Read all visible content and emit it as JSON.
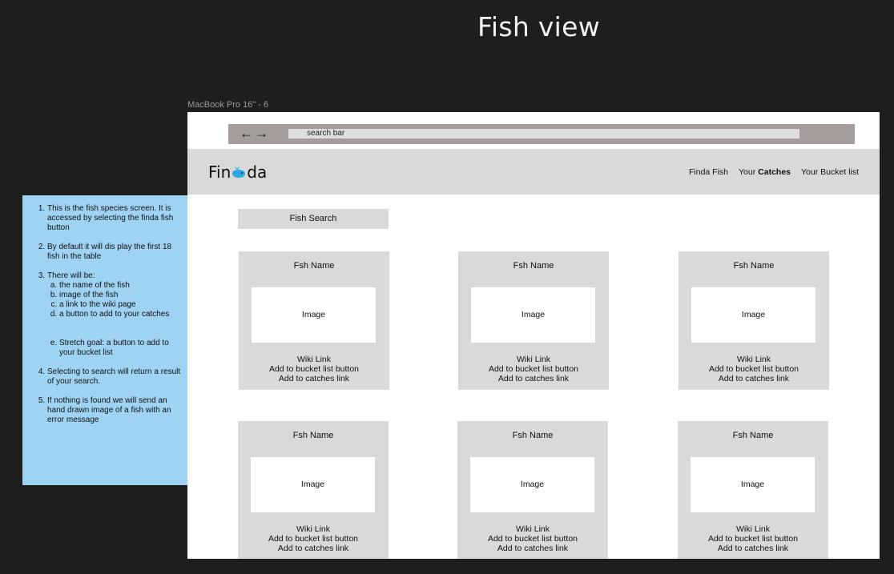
{
  "page_title": "Fish view",
  "frame_label": "MacBook Pro 16\" - 6",
  "browser": {
    "back_arrow": "←",
    "forward_arrow": "→",
    "search_text": "search bar"
  },
  "header": {
    "logo_prefix": "Fin",
    "logo_suffix": "da",
    "nav_finda": "Finda Fish",
    "nav_your": "Your",
    "nav_catches": "Catches",
    "nav_bucket": "Your Bucket list"
  },
  "fish_search_label": "Fish Search",
  "cards": [
    {
      "name": "Fsh Name",
      "image": "Image",
      "wiki": "Wiki Link",
      "bucket": "Add to bucket list button",
      "catches": "Add to catches link"
    },
    {
      "name": "Fsh Name",
      "image": "Image",
      "wiki": "Wiki Link",
      "bucket": "Add to bucket list button",
      "catches": "Add to catches link"
    },
    {
      "name": "Fsh Name",
      "image": "Image",
      "wiki": "Wiki Link",
      "bucket": "Add to bucket list button",
      "catches": "Add to catches link"
    },
    {
      "name": "Fsh Name",
      "image": "Image",
      "wiki": "Wiki Link",
      "bucket": "Add to bucket list button",
      "catches": "Add to catches link"
    },
    {
      "name": "Fsh Name",
      "image": "Image",
      "wiki": "Wiki Link",
      "bucket": "Add to bucket list button",
      "catches": "Add to catches link"
    },
    {
      "name": "Fsh Name",
      "image": "Image",
      "wiki": "Wiki Link",
      "bucket": "Add to bucket list button",
      "catches": "Add to catches link"
    }
  ],
  "notes": {
    "item1": "This is the fish species screen. It is accessed by selecting the finda fish button",
    "item2": "By default it will dis play the first 18 fish in the table",
    "item3": "There will be:",
    "item3_a": " the name of the fish",
    "item3_b": "image of the fish",
    "item3_c": "a link to the wiki page",
    "item3_d": "a button to add to your catches",
    "item3_e": "Stretch goal: a  button to add to your bucket list",
    "item4": "Selecting to search will return a result of your search.",
    "item5": "If nothing is found we will send an hand drawn image of a fish with an error message"
  },
  "colors": {
    "background": "#1e1e1e",
    "frame": "#ffffff",
    "panel_gray": "#d9d9d9",
    "browser_bar": "#a59d9c",
    "notes": "#9fd3f4",
    "whale": "#2aa7e0"
  },
  "icons": {
    "logo_mark": "whale-icon",
    "back": "back-arrow-icon",
    "forward": "forward-arrow-icon"
  }
}
